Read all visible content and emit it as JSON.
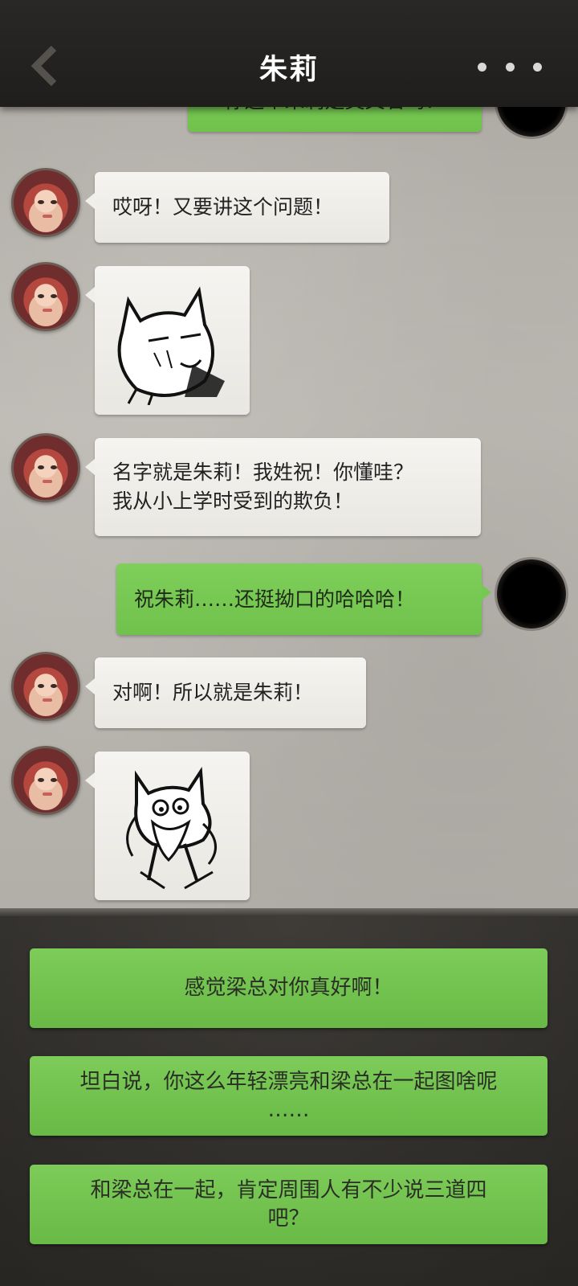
{
  "header": {
    "title": "朱莉"
  },
  "messages": [
    {
      "side": "right",
      "type": "text",
      "text": "你这个朱莉是英文名吗？"
    },
    {
      "side": "left",
      "type": "text",
      "text": "哎呀！又要讲这个问题！"
    },
    {
      "side": "left",
      "type": "sticker",
      "sticker": "cat-grimace-sticker"
    },
    {
      "side": "left",
      "type": "text",
      "lines": [
        "名字就是朱莉！我姓祝！你懂哇？",
        "我从小上学时受到的欺负！"
      ]
    },
    {
      "side": "right",
      "type": "text",
      "text": "祝朱莉……还挺拗口的哈哈哈！"
    },
    {
      "side": "left",
      "type": "text",
      "text": "对啊！所以就是朱莉！"
    },
    {
      "side": "left",
      "type": "sticker",
      "sticker": "cat-tongue-sticker"
    }
  ],
  "options": [
    {
      "lines": [
        "感觉梁总对你真好啊！"
      ]
    },
    {
      "lines": [
        "坦白说，你这么年轻漂亮和梁总在一起图啥呢",
        "……"
      ]
    },
    {
      "lines": [
        "和梁总在一起，肯定周围人有不少说三道四",
        "吧？"
      ]
    }
  ],
  "colors": {
    "header_bg": "#1f1e1c",
    "left_bubble": "#f0efeb",
    "right_bubble": "#77c853",
    "option_button": "#74c450"
  }
}
